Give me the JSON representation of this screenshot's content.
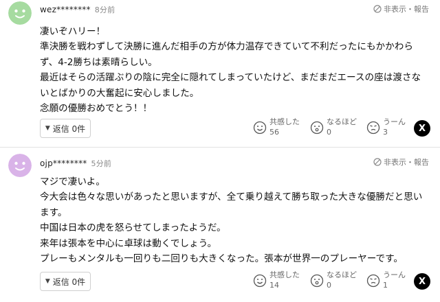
{
  "comments": [
    {
      "username": "wez********",
      "time": "8分前",
      "report_label": "非表示・報告",
      "avatar_color": "#a6dba0",
      "lines": [
        "凄いぞハリー！",
        "準決勝を戦わずして決勝に進んだ相手の方が体力温存できていて不利だったにもかかわら",
        "ず、4-2勝ちは素晴らしい。",
        "最近はそらの活躍ぶりの陰に完全に隠れてしまっていたけど、まだまだエースの座は渡さな",
        "いとばかりの大奮起に安心しました。",
        "念願の優勝おめでとう！！"
      ],
      "reply_label": "返信 0件",
      "reactions": [
        {
          "label": "共感した",
          "count": "56",
          "icon": "smile-icon"
        },
        {
          "label": "なるほど",
          "count": "0",
          "icon": "surprised-icon"
        },
        {
          "label": "うーん",
          "count": "3",
          "icon": "hmm-icon"
        }
      ],
      "share_label": "X"
    },
    {
      "username": "ojp********",
      "time": "5分前",
      "report_label": "非表示・報告",
      "avatar_color": "#d9b3e8",
      "lines": [
        "マジで凄いよ。",
        "今大会は色々な思いがあったと思いますが、全て乗り越えて勝ち取った大きな優勝だと思い",
        "ます。",
        "中国は日本の虎を怒らせてしまったようだ。",
        "来年は張本を中心に卓球は動くでしょう。",
        "プレーもメンタルも一回りも二回りも大きくなった。張本が世界一のプレーヤーです。"
      ],
      "reply_label": "返信 0件",
      "reactions": [
        {
          "label": "共感した",
          "count": "14",
          "icon": "smile-icon"
        },
        {
          "label": "なるほど",
          "count": "0",
          "icon": "surprised-icon"
        },
        {
          "label": "うーん",
          "count": "1",
          "icon": "hmm-icon"
        }
      ],
      "share_label": "X"
    }
  ]
}
